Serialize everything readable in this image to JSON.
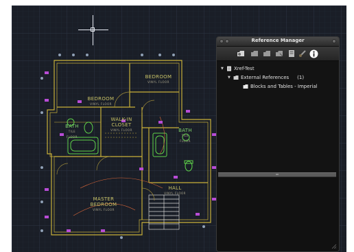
{
  "panel": {
    "title": "Reference Manager",
    "toolbar": [
      {
        "name": "attach-reference-icon",
        "color": "#d8d8d8"
      },
      {
        "name": "reload-icon",
        "color": "#9a9a9a"
      },
      {
        "name": "unload-icon",
        "color": "#9a9a9a"
      },
      {
        "name": "detach-icon",
        "color": "#9a9a9a"
      },
      {
        "name": "open-icon",
        "color": "#bdbdbd"
      },
      {
        "name": "bind-icon",
        "color": "#9a9a9a"
      },
      {
        "name": "info-icon",
        "color": "#ffffff"
      }
    ],
    "tree": {
      "root_label": "Xref-Test",
      "group_label": "External References",
      "group_count": "(1)",
      "item_label": "Blocks and Tables - Imperial"
    }
  },
  "drawing": {
    "rooms": {
      "bedroom_top": {
        "title": "BEDROOM",
        "sub": "VINYL FLOOR"
      },
      "bedroom_left": {
        "title": "BEDROOM",
        "sub": "VINYL FLOOR"
      },
      "walkin_closet": {
        "title": "WALK-IN CLOSET",
        "sub": "VINYL FLOOR"
      },
      "bath_left": {
        "title": "BATH",
        "sub": "TILE FLOOR"
      },
      "bath_right": {
        "title": "BATH",
        "sub": "TILE FLOOR"
      },
      "master": {
        "title": "MASTER BEDROOM",
        "sub": "VINYL FLOOR"
      },
      "hall": {
        "title": "HALL",
        "sub": "VINYL FLOOR"
      }
    }
  },
  "colors": {
    "canvas_bg": "#1a1e27",
    "walls": "#c9b13a",
    "fixtures": "#5ed24a",
    "callouts": "#b84cd6",
    "dimensions": "#8fa0b5"
  }
}
